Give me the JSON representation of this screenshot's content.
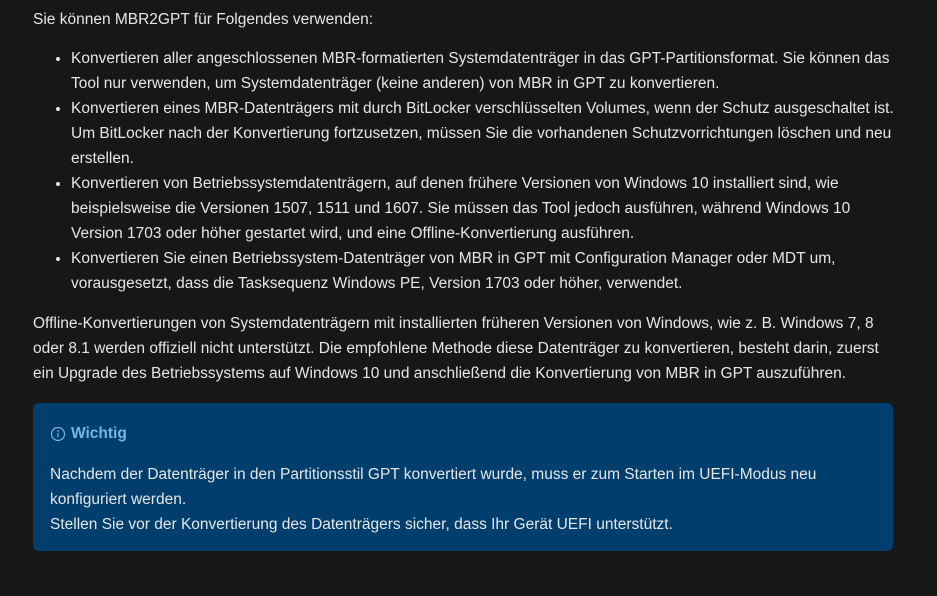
{
  "intro": "Sie können MBR2GPT für Folgendes verwenden:",
  "bullets": [
    "Konvertieren aller angeschlossenen MBR-formatierten Systemdatenträger in das GPT-Partitionsformat. Sie können das Tool nur verwenden, um Systemdatenträger (keine anderen) von MBR in GPT zu konvertieren.",
    "Konvertieren eines MBR-Datenträgers mit durch BitLocker verschlüsselten Volumes, wenn der Schutz ausgeschaltet ist. Um BitLocker nach der Konvertierung fortzusetzen, müssen Sie die vorhandenen Schutzvorrichtungen löschen und neu erstellen.",
    "Konvertieren von Betriebssystemdatenträgern, auf denen frühere Versionen von Windows 10 installiert sind, wie beispielsweise die Versionen 1507, 1511 und 1607. Sie müssen das Tool jedoch ausführen, während Windows 10 Version 1703 oder höher gestartet wird, und eine Offline-Konvertierung ausführen.",
    "Konvertieren Sie einen Betriebssystem-Datenträger von MBR in GPT mit Configuration Manager oder MDT um, vorausgesetzt, dass die Tasksequenz Windows PE, Version 1703 oder höher, verwendet."
  ],
  "paragraph": "Offline-Konvertierungen von Systemdatenträgern mit installierten früheren Versionen von Windows, wie z. B. Windows 7, 8 oder 8.1 werden offiziell nicht unterstützt. Die empfohlene Methode diese Datenträger zu konvertieren, besteht darin, zuerst ein Upgrade des Betriebssystems auf Windows 10 und anschließend die Konvertierung von MBR in GPT auszuführen.",
  "alert": {
    "icon": "info-circle-icon",
    "title": "Wichtig",
    "line1": "Nachdem der Datenträger in den Partitionsstil GPT konvertiert wurde, muss er zum Starten im UEFI-Modus neu konfiguriert werden.",
    "line2": "Stellen Sie vor der Konvertierung des Datenträgers sicher, dass Ihr Gerät UEFI unterstützt."
  },
  "colors": {
    "background": "#171717",
    "text": "#e6e6e6",
    "alert_background": "#003e6e",
    "alert_title": "#75b6e7"
  }
}
